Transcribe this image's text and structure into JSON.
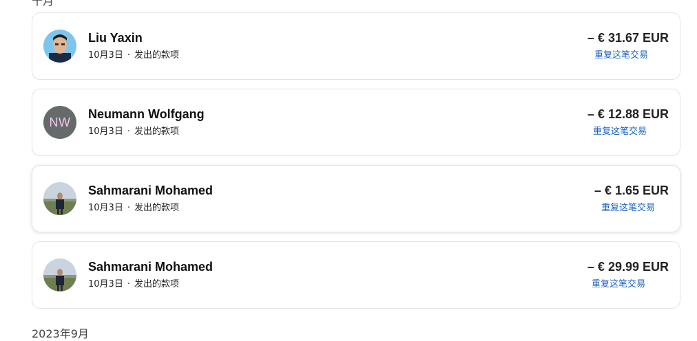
{
  "sections": {
    "top_label": "十月",
    "bottom_label": "2023年9月"
  },
  "colors": {
    "link": "#1a63c4",
    "card_border": "#e3e3e3",
    "initials_bg": "#656b6b",
    "initials_fg": "#f3c6ef"
  },
  "transactions": [
    {
      "name": "Liu Yaxin",
      "date": "10月3日",
      "separator": "·",
      "type": "发出的款项",
      "amount": "– € 31.67 EUR",
      "repeat_label": "重复这笔交易",
      "avatar": "photo"
    },
    {
      "name": "Neumann Wolfgang",
      "date": "10月3日",
      "separator": "·",
      "type": "发出的款项",
      "amount": "– € 12.88 EUR",
      "repeat_label": "重复这笔交易",
      "avatar": "initials",
      "initials": "NW"
    },
    {
      "name": "Sahmarani Mohamed",
      "date": "10月3日",
      "separator": "·",
      "type": "发出的款项",
      "amount": "– € 1.65 EUR",
      "repeat_label": "重复这笔交易",
      "avatar": "photo"
    },
    {
      "name": "Sahmarani Mohamed",
      "date": "10月3日",
      "separator": "·",
      "type": "发出的款项",
      "amount": "– € 29.99 EUR",
      "repeat_label": "重复这笔交易",
      "avatar": "photo"
    }
  ]
}
